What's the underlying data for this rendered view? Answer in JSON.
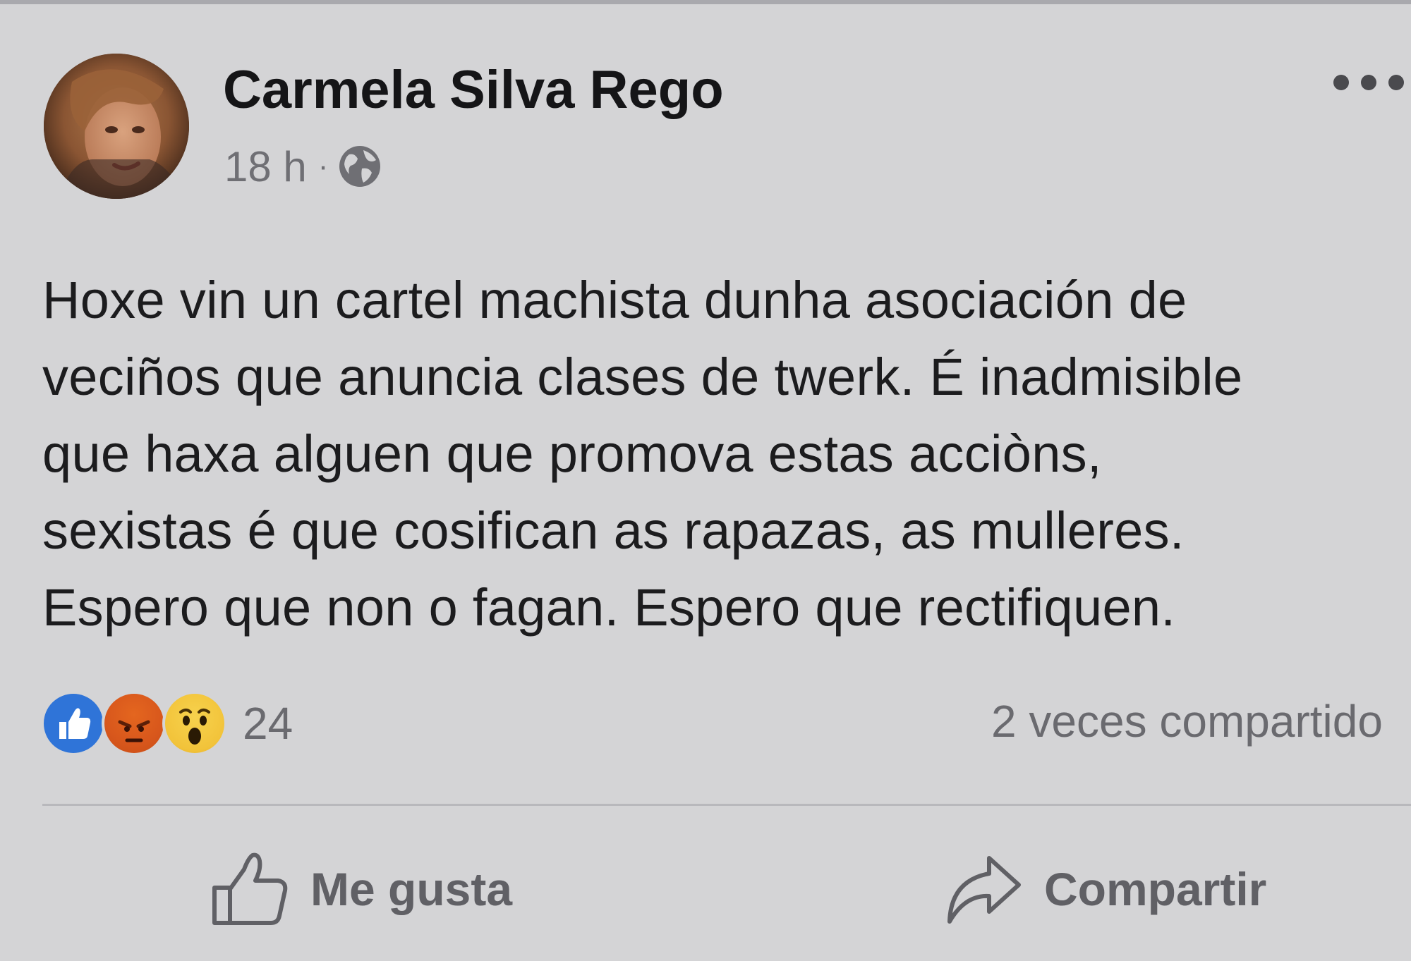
{
  "post": {
    "author": "Carmela Silva Rego",
    "time": "18 h",
    "separator": "·",
    "privacy_icon": "globe-icon",
    "more_icon": "more-options-icon",
    "body_lines": [
      "Hoxe vin un cartel machista dunha asociación de",
      "veciños que anuncia clases de twerk. É inadmisible",
      "que haxa alguen que promova estas acciòns,",
      "sexistas é que cosifican as rapazas, as mulleres.",
      "Espero que non o fagan. Espero que rectifiquen."
    ],
    "reactions": {
      "icons": [
        "like-reaction-icon",
        "angry-reaction-icon",
        "wow-reaction-icon"
      ],
      "count": "24"
    },
    "shares": "2 veces compartido"
  },
  "actions": {
    "like_label": "Me gusta",
    "share_label": "Compartir"
  },
  "colors": {
    "background": "#d4d4d6",
    "like_blue": "#2f74d8",
    "angry_orange": "#d8571c",
    "wow_yellow": "#f2c33a"
  }
}
